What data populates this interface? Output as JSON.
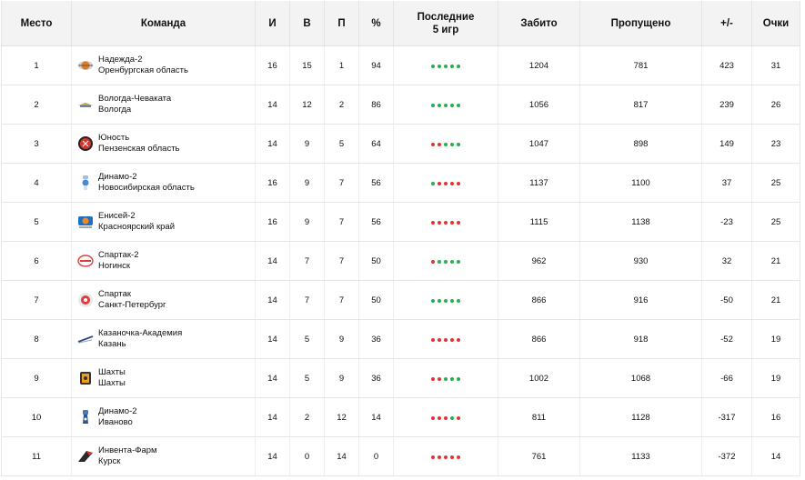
{
  "headers": {
    "place": "Место",
    "team": "Команда",
    "games": "И",
    "wins": "В",
    "losses": "П",
    "percent": "%",
    "last5_line1": "Последние",
    "last5_line2": "5 игр",
    "scored": "Забито",
    "conceded": "Пропущено",
    "diff": "+/-",
    "points": "Очки"
  },
  "colors": {
    "win": "#22b14c",
    "loss": "#e8312f",
    "header_bg": "#f3f3f3"
  },
  "rows": [
    {
      "place": "1",
      "name": "Надежда-2",
      "region": "Оренбургская область",
      "logo": "nadezhda-logo-icon",
      "games": "16",
      "wins": "15",
      "losses": "1",
      "percent": "94",
      "form": [
        "w",
        "w",
        "w",
        "w",
        "w"
      ],
      "scored": "1204",
      "conceded": "781",
      "diff": "423",
      "points": "31"
    },
    {
      "place": "2",
      "name": "Вологда-Чеваката",
      "region": "Вологда",
      "logo": "vologda-logo-icon",
      "games": "14",
      "wins": "12",
      "losses": "2",
      "percent": "86",
      "form": [
        "w",
        "w",
        "w",
        "w",
        "w"
      ],
      "scored": "1056",
      "conceded": "817",
      "diff": "239",
      "points": "26"
    },
    {
      "place": "3",
      "name": "Юность",
      "region": "Пензенская область",
      "logo": "yunost-logo-icon",
      "games": "14",
      "wins": "9",
      "losses": "5",
      "percent": "64",
      "form": [
        "l",
        "l",
        "w",
        "w",
        "w"
      ],
      "scored": "1047",
      "conceded": "898",
      "diff": "149",
      "points": "23"
    },
    {
      "place": "4",
      "name": "Динамо-2",
      "region": "Новосибирская область",
      "logo": "dinamo-nsk-logo-icon",
      "games": "16",
      "wins": "9",
      "losses": "7",
      "percent": "56",
      "form": [
        "w",
        "l",
        "l",
        "l",
        "l"
      ],
      "scored": "1137",
      "conceded": "1100",
      "diff": "37",
      "points": "25"
    },
    {
      "place": "5",
      "name": "Енисей-2",
      "region": "Красноярский край",
      "logo": "enisey-logo-icon",
      "games": "16",
      "wins": "9",
      "losses": "7",
      "percent": "56",
      "form": [
        "l",
        "l",
        "l",
        "l",
        "l"
      ],
      "scored": "1115",
      "conceded": "1138",
      "diff": "-23",
      "points": "25"
    },
    {
      "place": "6",
      "name": "Спартак-2",
      "region": "Ногинск",
      "logo": "spartak-noginsk-logo-icon",
      "games": "14",
      "wins": "7",
      "losses": "7",
      "percent": "50",
      "form": [
        "l",
        "w",
        "w",
        "w",
        "w"
      ],
      "scored": "962",
      "conceded": "930",
      "diff": "32",
      "points": "21"
    },
    {
      "place": "7",
      "name": "Спартак",
      "region": "Санкт-Петербург",
      "logo": "spartak-spb-logo-icon",
      "games": "14",
      "wins": "7",
      "losses": "7",
      "percent": "50",
      "form": [
        "w",
        "w",
        "w",
        "w",
        "w"
      ],
      "scored": "866",
      "conceded": "916",
      "diff": "-50",
      "points": "21"
    },
    {
      "place": "8",
      "name": "Казаночка-Академия",
      "region": "Казань",
      "logo": "kazanochka-logo-icon",
      "games": "14",
      "wins": "5",
      "losses": "9",
      "percent": "36",
      "form": [
        "l",
        "l",
        "l",
        "l",
        "l"
      ],
      "scored": "866",
      "conceded": "918",
      "diff": "-52",
      "points": "19"
    },
    {
      "place": "9",
      "name": "Шахты",
      "region": "Шахты",
      "logo": "shakhty-logo-icon",
      "games": "14",
      "wins": "5",
      "losses": "9",
      "percent": "36",
      "form": [
        "l",
        "l",
        "w",
        "w",
        "w"
      ],
      "scored": "1002",
      "conceded": "1068",
      "diff": "-66",
      "points": "19"
    },
    {
      "place": "10",
      "name": "Динамо-2",
      "region": "Иваново",
      "logo": "dinamo-ivanovo-logo-icon",
      "games": "14",
      "wins": "2",
      "losses": "12",
      "percent": "14",
      "form": [
        "l",
        "l",
        "l",
        "w",
        "l"
      ],
      "scored": "811",
      "conceded": "1128",
      "diff": "-317",
      "points": "16"
    },
    {
      "place": "11",
      "name": "Инвента-Фарм",
      "region": "Курск",
      "logo": "inventa-logo-icon",
      "games": "14",
      "wins": "0",
      "losses": "14",
      "percent": "0",
      "form": [
        "l",
        "l",
        "l",
        "l",
        "l"
      ],
      "scored": "761",
      "conceded": "1133",
      "diff": "-372",
      "points": "14"
    }
  ]
}
